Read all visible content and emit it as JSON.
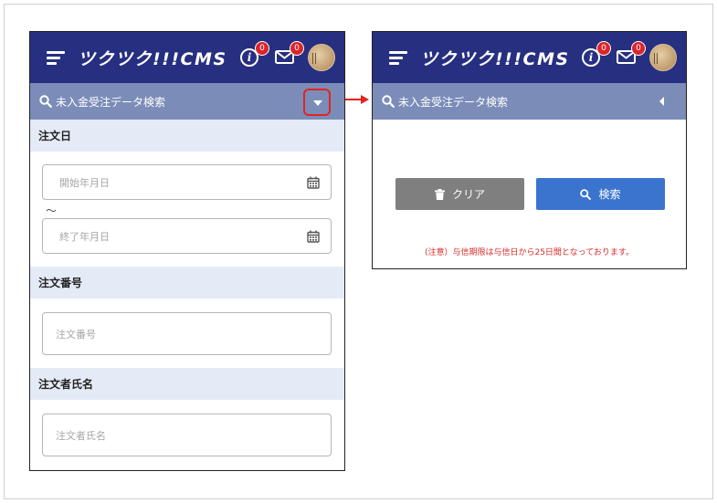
{
  "app": {
    "logo": "ツクツク!!!CMS",
    "info_badge": "0",
    "mail_badge": "0"
  },
  "search_bar": {
    "label": "未入金受注データ検索"
  },
  "form": {
    "order_date": {
      "heading": "注文日",
      "start_placeholder": "開始年月日",
      "separator": "～",
      "end_placeholder": "終了年月日"
    },
    "order_number": {
      "heading": "注文番号",
      "placeholder": "注文番号"
    },
    "orderer_name": {
      "heading": "注文者氏名",
      "placeholder": "注文者氏名"
    }
  },
  "actions": {
    "clear_label": "クリア",
    "search_label": "検索"
  },
  "notice": "(注意）与信期限は与信日から25日間となっております。",
  "colors": {
    "header_bg": "#262f80",
    "search_bar_bg": "#7b8cb8",
    "section_bg": "#e4ebf6",
    "badge": "#d9262c",
    "highlight": "#e2241f",
    "search_button": "#3b74cf",
    "clear_button": "#7f7f7f",
    "notice_text": "#d62a2a"
  },
  "icons": {
    "menu": "hamburger-menu-icon",
    "info": "info-icon",
    "mail": "mail-icon",
    "search": "search-icon",
    "calendar": "calendar-icon",
    "trash": "trash-icon",
    "expand": "caret-down-icon",
    "collapse": "caret-left-icon"
  }
}
